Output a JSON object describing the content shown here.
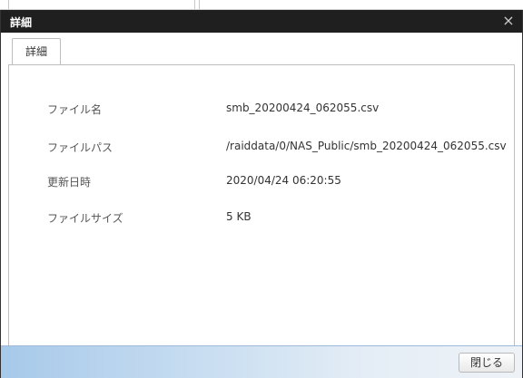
{
  "dialog": {
    "title": "詳細",
    "close_symbol": "×",
    "tabs": [
      {
        "label": "詳細"
      }
    ],
    "close_button": "閉じる"
  },
  "details": [
    {
      "label": "ファイル名",
      "value": "smb_20200424_062055.csv"
    },
    {
      "label": "ファイルパス",
      "value": "/raiddata/0/NAS_Public/smb_20200424_062055.csv"
    },
    {
      "label": "更新日時",
      "value": "2020/04/24 06:20:55"
    },
    {
      "label": "ファイルサイズ",
      "value": "5 KB"
    }
  ]
}
